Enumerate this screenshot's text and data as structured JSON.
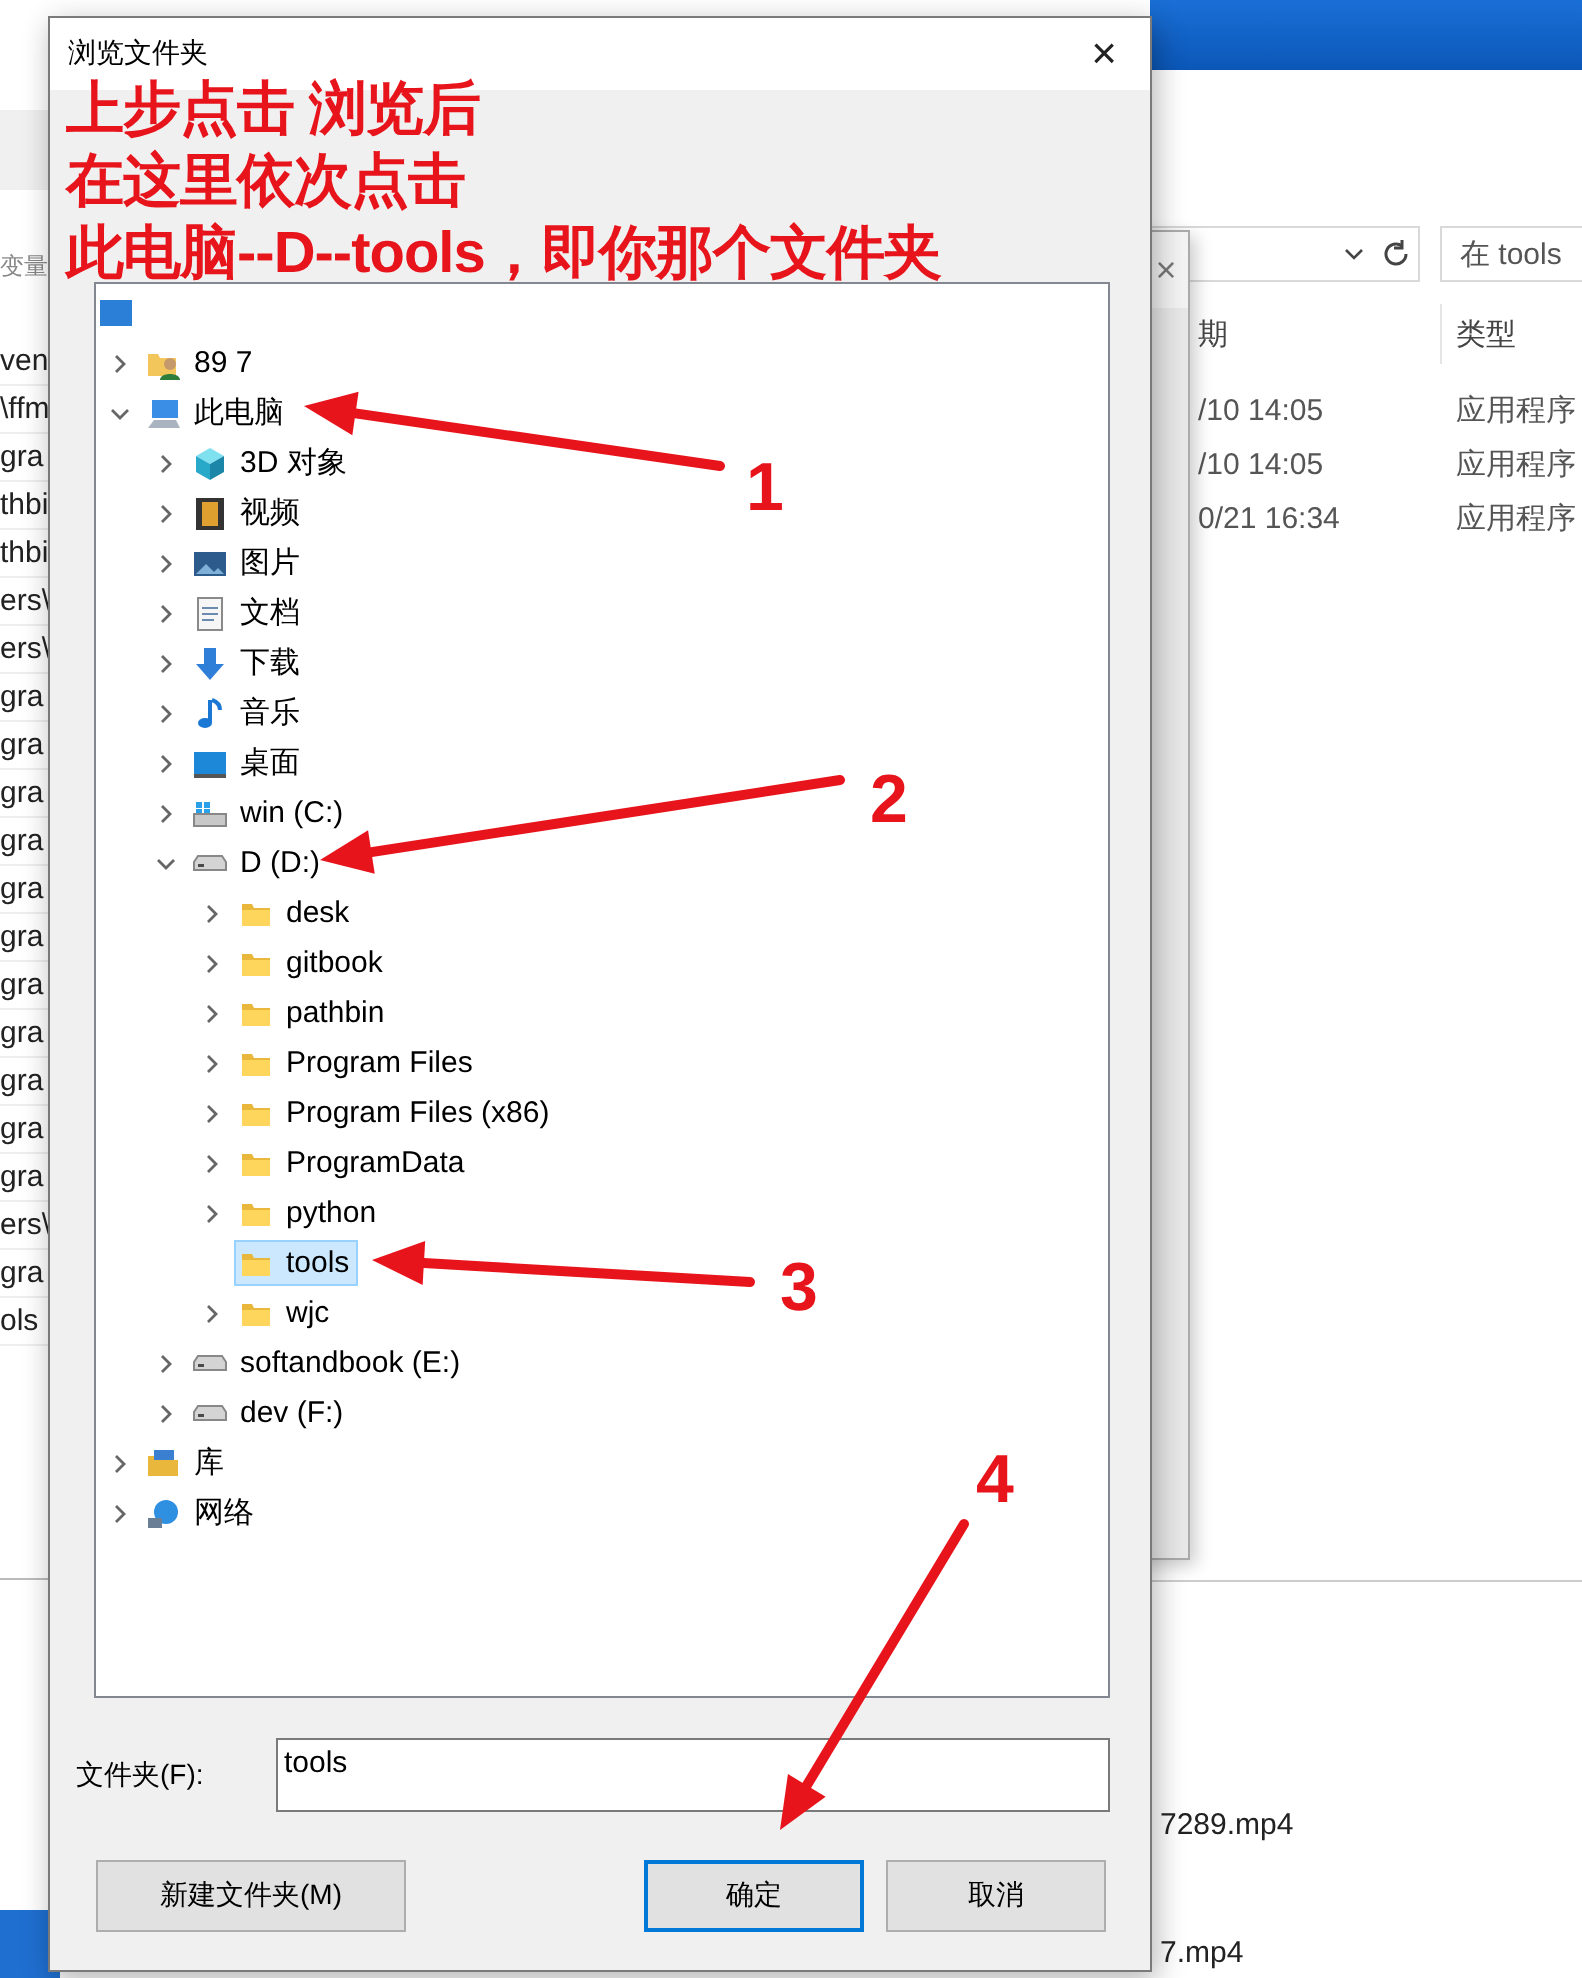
{
  "left_window": {
    "search_label": "变量",
    "rows": [
      "ven",
      "\\ffm",
      "gra",
      "thbi",
      "thbi",
      "ers\\",
      "ers\\",
      "gra",
      "gra",
      "gra",
      "gra",
      "gra",
      "gra",
      "gra",
      "gra",
      "gra",
      "gra",
      "gra",
      "ers\\",
      "gra",
      "ols"
    ]
  },
  "explorer": {
    "search_placeholder": "在 tools",
    "columns": [
      "期",
      "类型"
    ],
    "rows": [
      {
        "date": "/10 14:05",
        "type": "应用程序"
      },
      {
        "date": "/10 14:05",
        "type": "应用程序"
      },
      {
        "date": "0/21 16:34",
        "type": "应用程序"
      }
    ]
  },
  "middle_window": {
    "close": "×"
  },
  "files": [
    "7289.mp4",
    "7.mp4"
  ],
  "dialog": {
    "title": "浏览文件夹",
    "close": "×",
    "tree": [
      {
        "kind": "desktop",
        "children": [
          {
            "label": "89 7",
            "kind": "user",
            "expanded": false,
            "selected": false
          },
          {
            "label": "此电脑",
            "kind": "pc",
            "expanded": true,
            "selected": false,
            "children": [
              {
                "label": "3D 对象",
                "kind": "cube",
                "expanded": false,
                "selected": false
              },
              {
                "label": "视频",
                "kind": "video",
                "expanded": false,
                "selected": false
              },
              {
                "label": "图片",
                "kind": "picture",
                "expanded": false,
                "selected": false
              },
              {
                "label": "文档",
                "kind": "document",
                "expanded": false,
                "selected": false
              },
              {
                "label": "下载",
                "kind": "download",
                "expanded": false,
                "selected": false
              },
              {
                "label": "音乐",
                "kind": "music",
                "expanded": false,
                "selected": false
              },
              {
                "label": "桌面",
                "kind": "screen",
                "expanded": false,
                "selected": false
              },
              {
                "label": "win (C:)",
                "kind": "system-drive",
                "expanded": false,
                "selected": false
              },
              {
                "label": "D (D:)",
                "kind": "drive",
                "expanded": true,
                "selected": false,
                "children": [
                  {
                    "label": "desk",
                    "kind": "folder",
                    "expanded": false,
                    "selected": false
                  },
                  {
                    "label": "gitbook",
                    "kind": "folder",
                    "expanded": false,
                    "selected": false
                  },
                  {
                    "label": "pathbin",
                    "kind": "folder",
                    "expanded": false,
                    "selected": false
                  },
                  {
                    "label": "Program Files",
                    "kind": "folder",
                    "expanded": false,
                    "selected": false
                  },
                  {
                    "label": "Program Files (x86)",
                    "kind": "folder",
                    "expanded": false,
                    "selected": false
                  },
                  {
                    "label": "ProgramData",
                    "kind": "folder",
                    "expanded": false,
                    "selected": false
                  },
                  {
                    "label": "python",
                    "kind": "folder",
                    "expanded": false,
                    "selected": false
                  },
                  {
                    "label": "tools",
                    "kind": "folder",
                    "selected": true
                  },
                  {
                    "label": "wjc",
                    "kind": "folder",
                    "expanded": false,
                    "selected": false
                  }
                ]
              },
              {
                "label": "softandbook (E:)",
                "kind": "drive",
                "expanded": false,
                "selected": false
              },
              {
                "label": "dev (F:)",
                "kind": "drive",
                "expanded": false,
                "selected": false
              }
            ]
          },
          {
            "label": "库",
            "kind": "library",
            "expanded": false,
            "selected": false
          },
          {
            "label": "网络",
            "kind": "network",
            "expanded": false,
            "selected": false
          }
        ]
      }
    ],
    "folder_field": {
      "label": "文件夹(F):",
      "value": "tools"
    },
    "buttons": [
      {
        "label": "新建文件夹(M)",
        "default": false
      },
      {
        "label": "确定",
        "default": true
      },
      {
        "label": "取消",
        "default": false
      }
    ]
  },
  "annotations": {
    "lines": [
      "上步点击 浏览后",
      "在这里依次点击",
      "此电脑--D--tools，即你那个文件夹"
    ],
    "markers": [
      "1",
      "2",
      "3",
      "4"
    ]
  }
}
